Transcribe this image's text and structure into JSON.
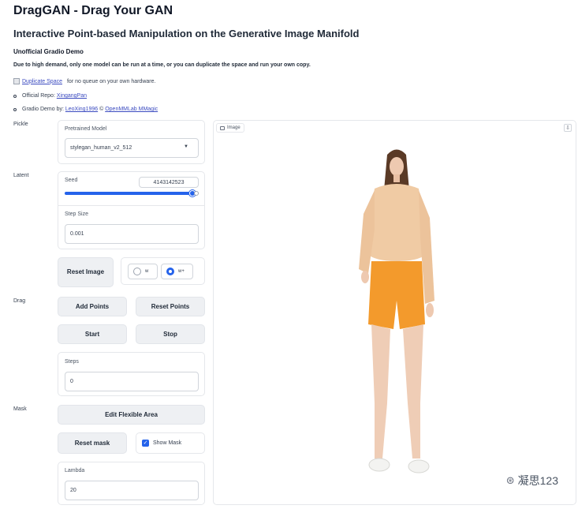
{
  "header": {
    "title": "DragGAN - Drag Your GAN",
    "subtitle": "Interactive Point-based Manipulation on the Generative Image Manifold",
    "unofficial": "Unofficial Gradio Demo",
    "notice": "Due to high demand, only one model can be run at a time, or you can duplicate the space and run your own copy."
  },
  "duplicate": {
    "link_text": "Duplicate Space",
    "suffix": "for no queue on your own hardware."
  },
  "links": {
    "repo_prefix": "Official Repo:",
    "repo_link": "XingangPan",
    "demo_prefix": "Gradio Demo by:",
    "demo_link1": "LeoXing1996",
    "demo_sep": "©",
    "demo_link2": "OpenMMLab MMagic"
  },
  "sections": {
    "pickle": "Pickle",
    "latent": "Latent",
    "drag": "Drag",
    "mask": "Mask"
  },
  "pickle": {
    "label": "Pretrained Model",
    "value": "stylegan_human_v2_512"
  },
  "latent": {
    "seed_label": "Seed",
    "seed_value": "4143142523",
    "seed_fraction": 1.0,
    "step_label": "Step Size",
    "step_value": "0.001",
    "reset_label": "Reset Image",
    "radio_w": "w",
    "radio_wplus": "w+",
    "selected": "w+"
  },
  "drag": {
    "add_points": "Add Points",
    "reset_points": "Reset Points",
    "start": "Start",
    "stop": "Stop",
    "steps_label": "Steps",
    "steps_value": "0"
  },
  "mask": {
    "edit_flexible": "Edit Flexible Area",
    "reset_mask": "Reset mask",
    "show_mask": "Show Mask",
    "show_mask_checked": true,
    "lambda_label": "Lambda",
    "lambda_value": "20"
  },
  "image": {
    "tag": "Image",
    "watermark": "凝思123"
  },
  "colors": {
    "accent": "#2563eb",
    "button_bg": "#eef0f3",
    "shorts": "#f39a2c",
    "sweater": "#f0cba4"
  }
}
